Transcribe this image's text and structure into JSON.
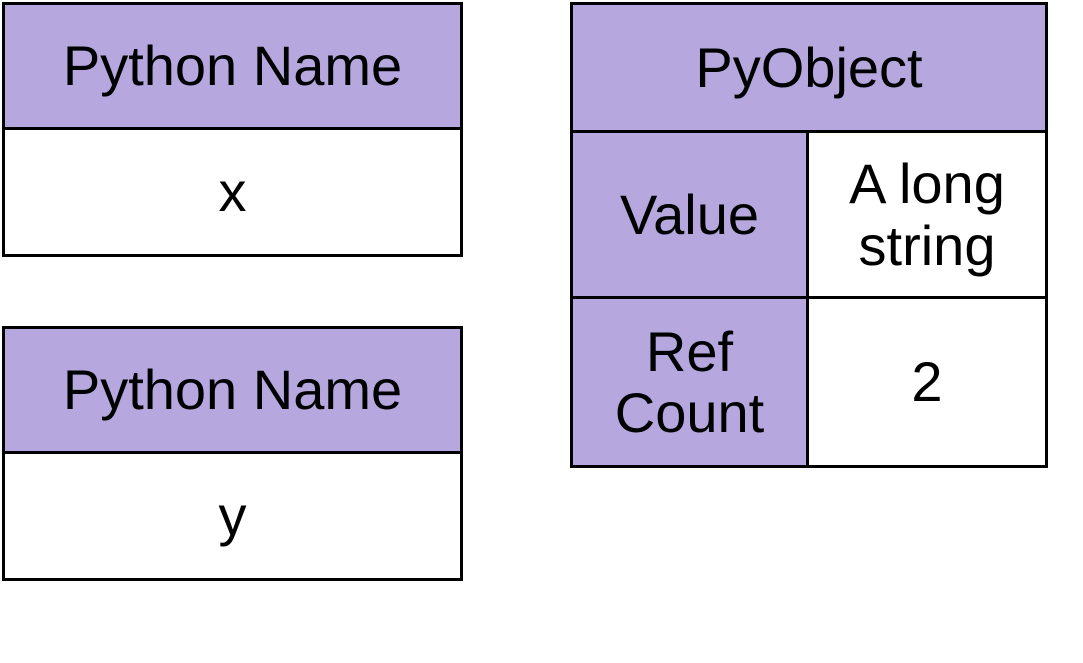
{
  "nameBoxX": {
    "title": "Python Name",
    "value": "x"
  },
  "nameBoxY": {
    "title": "Python Name",
    "value": "y"
  },
  "pyObject": {
    "title": "PyObject",
    "valueLabel": "Value",
    "valueContent": "A long string",
    "refCountLabel": "Ref Count",
    "refCountValue": "2"
  }
}
